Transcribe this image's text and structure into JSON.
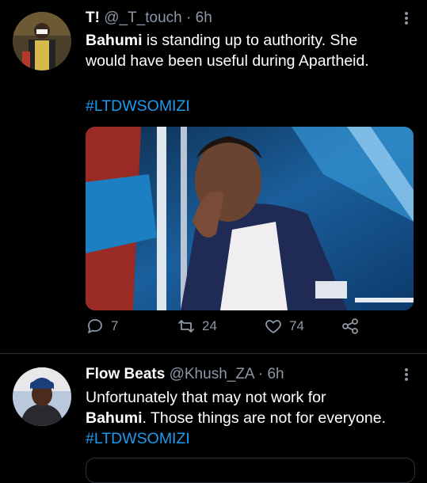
{
  "tweets": [
    {
      "name": "T!",
      "handle": "@_T_touch",
      "separator": "·",
      "time": "6h",
      "text": {
        "bold_start": "Bahumi",
        "line1_rest": " is standing up to authority. She",
        "line2": "would have been useful during Apartheid."
      },
      "hashtag": "#LTDWSOMIZI",
      "stats": {
        "replies": "7",
        "retweets": "24",
        "likes": "74"
      }
    },
    {
      "name": "Flow Beats",
      "handle": "@Khush_ZA",
      "separator": "·",
      "time": "6h",
      "text": {
        "line1": "Unfortunately that may not work for",
        "bold_start": "Bahumi",
        "line2_rest": ". Those things are not for everyone.",
        "hashtag": "#LTDWSOMIZI"
      }
    }
  ],
  "icons": {
    "reply": "reply-icon",
    "retweet": "retweet-icon",
    "like": "heart-icon",
    "share": "share-icon",
    "more": "more-vertical-icon"
  },
  "colors": {
    "background": "#000000",
    "accent": "#1d9bf0",
    "muted": "#8b98a5",
    "text": "#ffffff"
  }
}
